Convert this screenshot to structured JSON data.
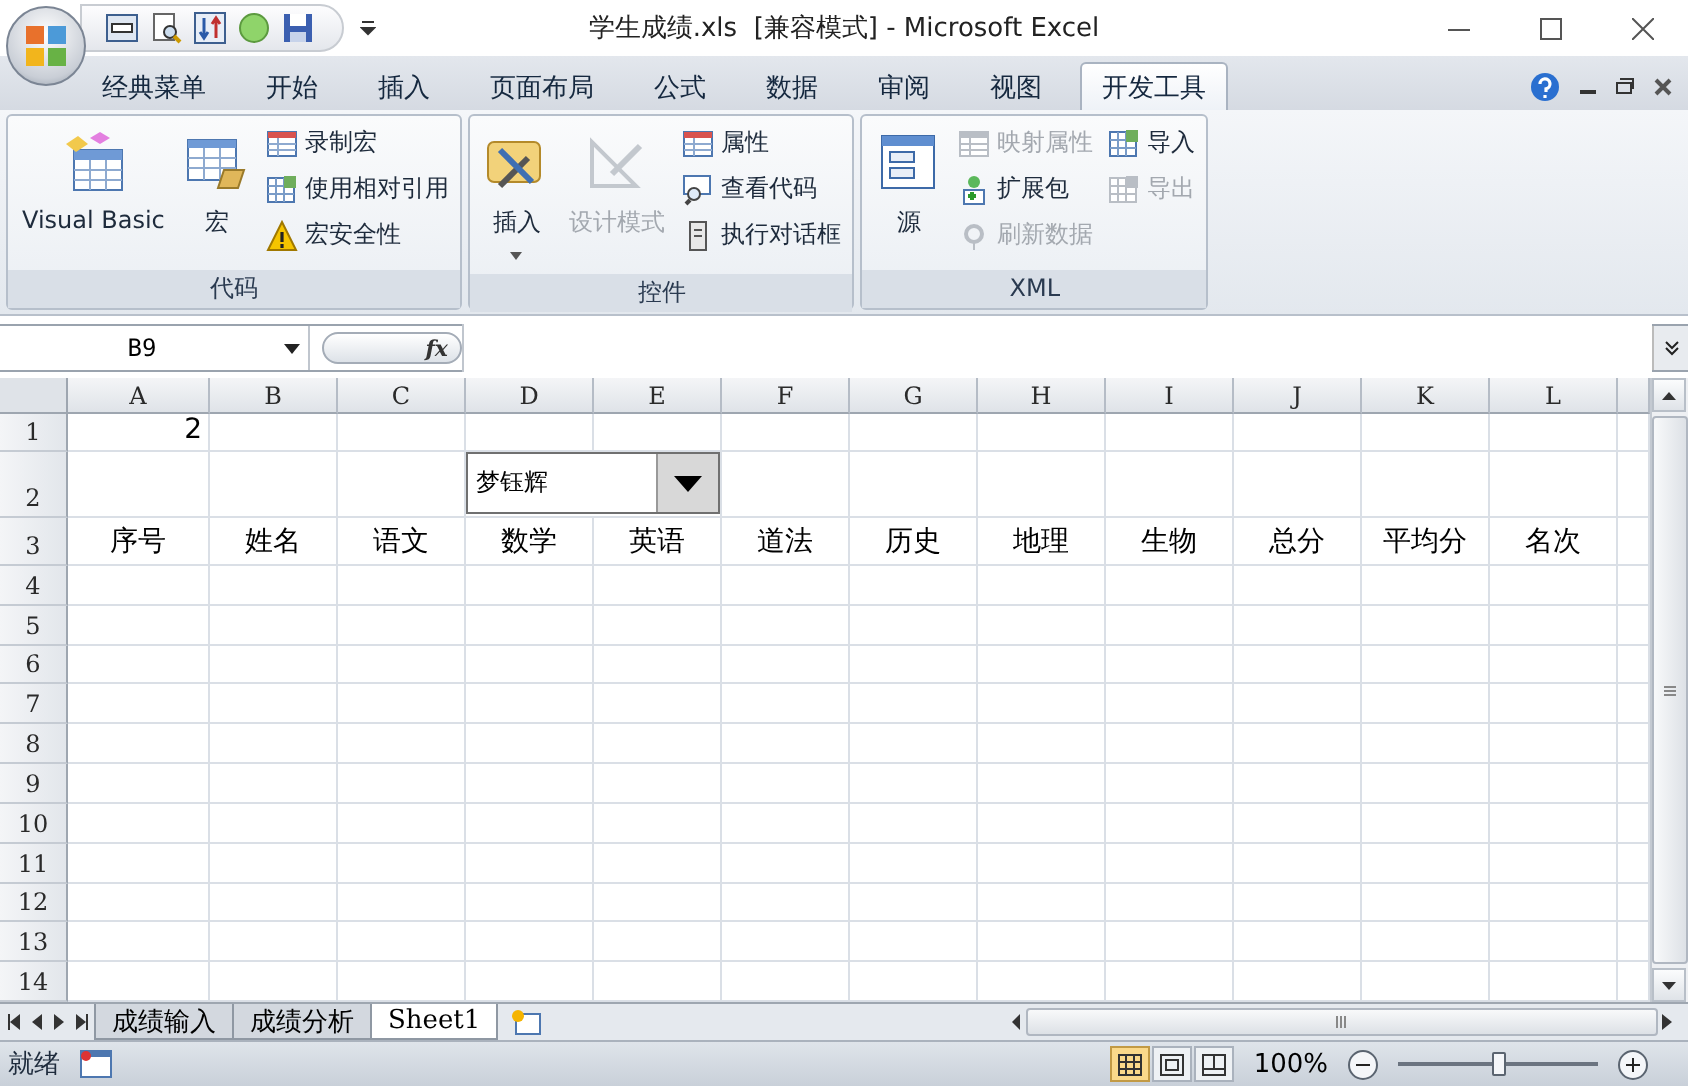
{
  "window": {
    "title": "学生成绩.xls  [兼容模式] - Microsoft Excel"
  },
  "tabs": [
    {
      "label": "经典菜单",
      "selected": false
    },
    {
      "label": "开始",
      "selected": false
    },
    {
      "label": "插入",
      "selected": false
    },
    {
      "label": "页面布局",
      "selected": false
    },
    {
      "label": "公式",
      "selected": false
    },
    {
      "label": "数据",
      "selected": false
    },
    {
      "label": "审阅",
      "selected": false
    },
    {
      "label": "视图",
      "selected": false
    },
    {
      "label": "开发工具",
      "selected": true
    }
  ],
  "ribbon": [
    {
      "label": "代码",
      "items": [
        {
          "kind": "large",
          "label": "Visual Basic",
          "disabled": false
        },
        {
          "kind": "large",
          "label": "宏",
          "disabled": false
        },
        {
          "kind": "small",
          "label": "录制宏",
          "disabled": false
        },
        {
          "kind": "small",
          "label": "使用相对引用",
          "disabled": false
        },
        {
          "kind": "small",
          "label": "宏安全性",
          "disabled": false
        }
      ]
    },
    {
      "label": "控件",
      "items": [
        {
          "kind": "large",
          "label": "插入",
          "disabled": false,
          "caret": true
        },
        {
          "kind": "large",
          "label": "设计模式",
          "disabled": true
        },
        {
          "kind": "small",
          "label": "属性",
          "disabled": false
        },
        {
          "kind": "small",
          "label": "查看代码",
          "disabled": false
        },
        {
          "kind": "small",
          "label": "执行对话框",
          "disabled": false
        }
      ]
    },
    {
      "label": "XML",
      "items": [
        {
          "kind": "large",
          "label": "源",
          "disabled": false
        },
        {
          "kind": "small",
          "label": "映射属性",
          "disabled": true
        },
        {
          "kind": "small",
          "label": "扩展包",
          "disabled": false
        },
        {
          "kind": "small",
          "label": "刷新数据",
          "disabled": true
        },
        {
          "kind": "small",
          "label": "导入",
          "disabled": false
        },
        {
          "kind": "small",
          "label": "导出",
          "disabled": true
        }
      ]
    }
  ],
  "name_box": "B9",
  "formula_label": "fx",
  "columns": [
    "A",
    "B",
    "C",
    "D",
    "E",
    "F",
    "G",
    "H",
    "I",
    "J",
    "K",
    "L"
  ],
  "rows": [
    {
      "header": "1",
      "cells": [
        {
          "kind": "number",
          "text": "2"
        }
      ]
    },
    {
      "header": "2",
      "cells": []
    },
    {
      "header": "3",
      "cells": [
        {
          "kind": "text",
          "text": "序号"
        },
        {
          "kind": "text",
          "text": "姓名"
        },
        {
          "kind": "text",
          "text": "语文"
        },
        {
          "kind": "text",
          "text": "数学"
        },
        {
          "kind": "text",
          "text": "英语"
        },
        {
          "kind": "text",
          "text": "道法"
        },
        {
          "kind": "text",
          "text": "历史"
        },
        {
          "kind": "text",
          "text": "地理"
        },
        {
          "kind": "text",
          "text": "生物"
        },
        {
          "kind": "text",
          "text": "总分"
        },
        {
          "kind": "text",
          "text": "平均分"
        },
        {
          "kind": "text",
          "text": "名次"
        }
      ]
    },
    {
      "header": "4",
      "cells": []
    },
    {
      "header": "5",
      "cells": []
    },
    {
      "header": "6",
      "cells": []
    },
    {
      "header": "7",
      "cells": []
    },
    {
      "header": "8",
      "cells": []
    },
    {
      "header": "9",
      "cells": []
    },
    {
      "header": "10",
      "cells": []
    },
    {
      "header": "11",
      "cells": []
    },
    {
      "header": "12",
      "cells": []
    },
    {
      "header": "13",
      "cells": []
    },
    {
      "header": "14",
      "cells": []
    }
  ],
  "combo_box": {
    "value": "梦钰辉"
  },
  "sheet_tabs": [
    {
      "label": "成绩输入",
      "selected": false
    },
    {
      "label": "成绩分析",
      "selected": false
    },
    {
      "label": "Sheet1",
      "selected": true
    }
  ],
  "status_bar": {
    "status": "就绪",
    "views": [
      {
        "selected": true
      },
      {
        "selected": false
      },
      {
        "selected": false
      }
    ],
    "zoom": "100%",
    "zoom_slider": {
      "level": 0.5
    }
  }
}
